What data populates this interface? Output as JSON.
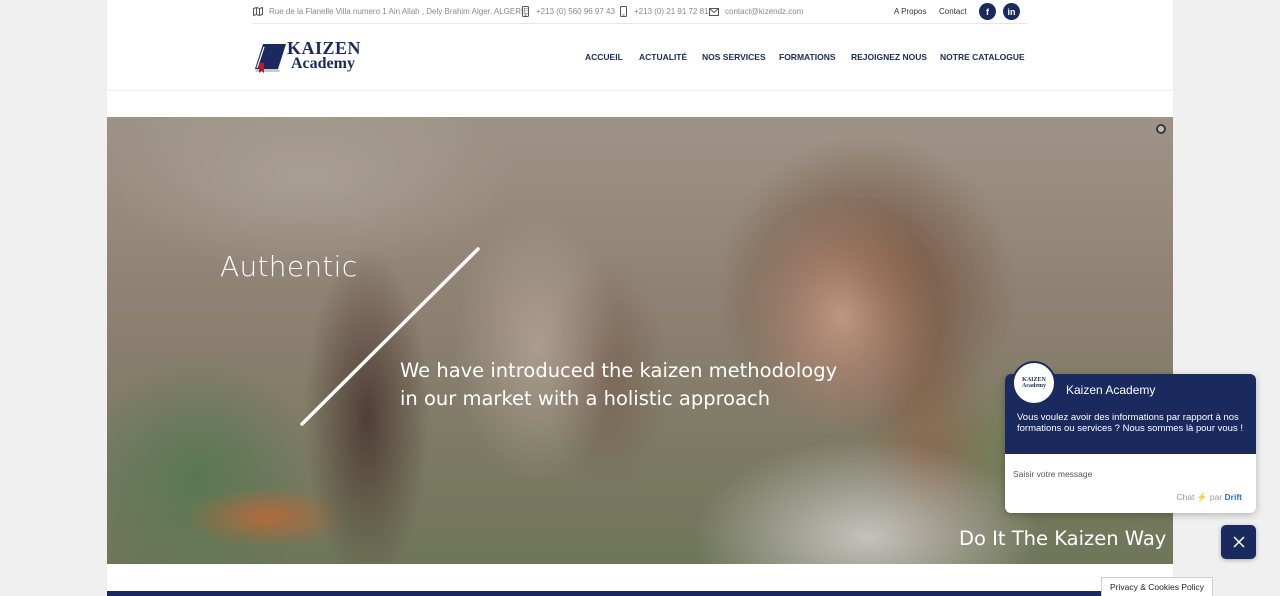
{
  "topbar": {
    "address": "Rue de la Flanelle Villa numero 1 Ain Allah , Dely Brahim Alger, ALGERIE",
    "phone1": "+213 (0) 560 96 97 43",
    "phone2": "+213 (0) 21 91 72 81",
    "email": "contact@kizendz.com",
    "links": [
      "A Propos",
      "Contact"
    ],
    "social": [
      "f",
      "in"
    ]
  },
  "logo": {
    "line1": "KAIZEN",
    "line2": "Academy"
  },
  "nav": {
    "items": [
      "ACCUEIL",
      "ACTUALITÉ",
      "NOS SERVICES",
      "FORMATIONS",
      "REJOIGNEZ NOUS",
      "NOTRE CATALOGUE"
    ]
  },
  "hero": {
    "title": "Authentic",
    "subtitle_line1": "We have introduced the kaizen methodology",
    "subtitle_line2": "in our market with a holistic approach",
    "tagline": "Do It The Kaizen Way"
  },
  "chat": {
    "avatar_text": [
      "KAIZEN",
      "Academy"
    ],
    "name": "Kaizen Academy",
    "message": "Vous voulez avoir des informations par rapport à nos formations ou services ? Nous sommes là pour vous !",
    "input_placeholder": "Saisir votre message",
    "credit_chat": "Chat",
    "credit_bolt": "⚡",
    "credit_by": "par",
    "credit_brand": "Drift"
  },
  "privacy": {
    "label": "Privacy & Cookies Policy"
  },
  "colors": {
    "brand_navy": "#1a2a5e",
    "drift_blue": "#2d6cd4",
    "bolt_yellow": "#f5b800"
  }
}
